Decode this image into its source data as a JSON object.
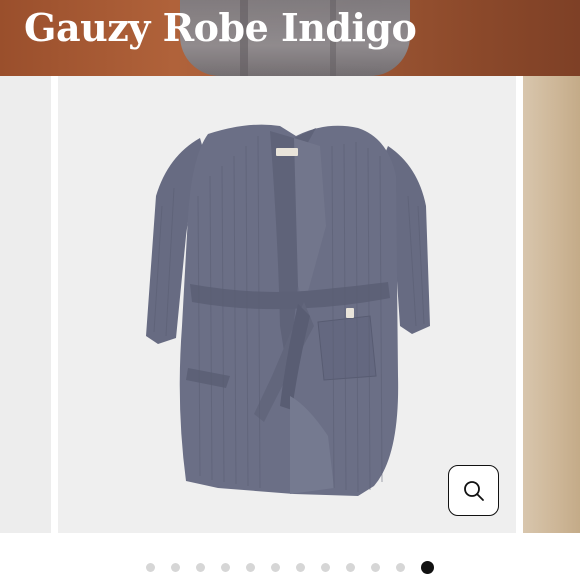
{
  "product": {
    "title": "Gauzy Robe Indigo"
  },
  "colors": {
    "hero_bg": "#a15a37",
    "robe": "#6b6f86",
    "gallery_bg": "#efefef",
    "dot_inactive": "#d6d6d6",
    "dot_active": "#111111"
  },
  "gallery": {
    "zoom_icon": "magnifier-icon",
    "dots_total": 12,
    "active_dot": 12
  }
}
